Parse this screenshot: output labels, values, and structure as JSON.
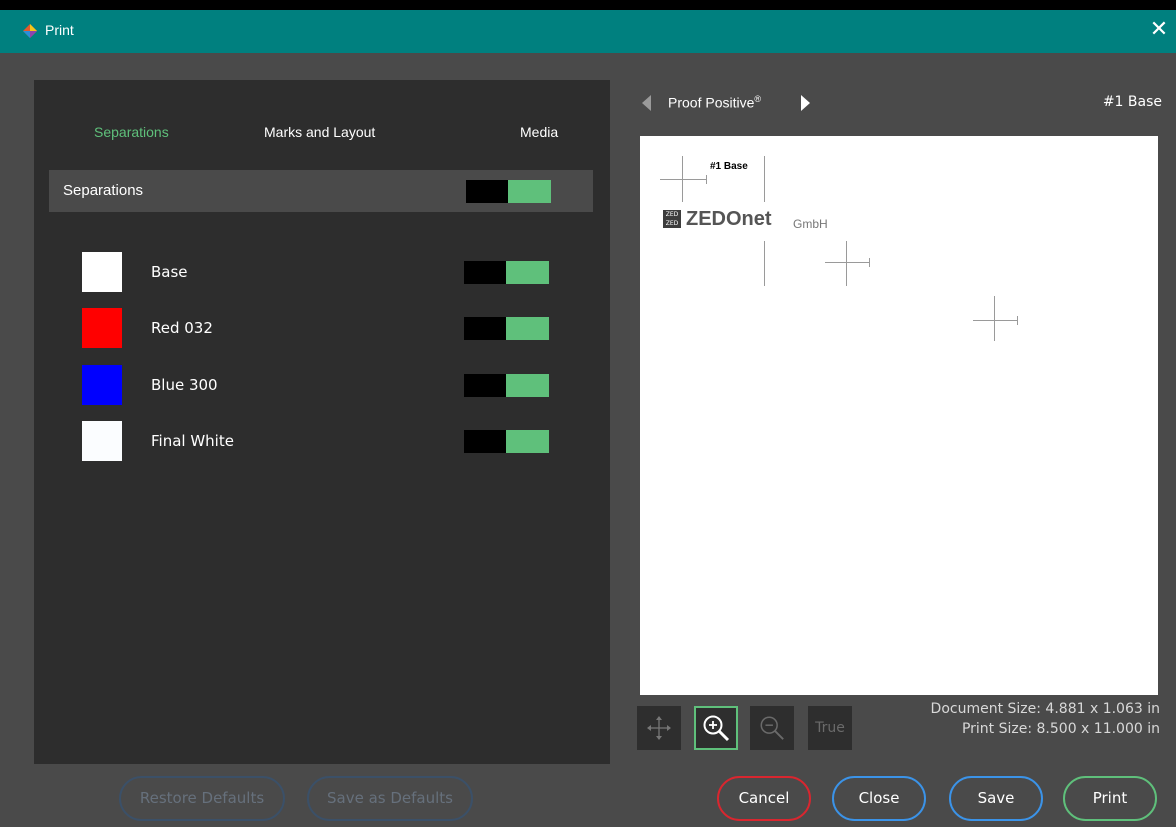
{
  "window": {
    "title": "Print",
    "app_icon": "print-app-icon",
    "close_icon": "close-icon"
  },
  "tabs": [
    {
      "label": "Separations",
      "active": true
    },
    {
      "label": "Marks and Layout",
      "active": false
    },
    {
      "label": "Media",
      "active": false
    }
  ],
  "separations": {
    "header_label": "Separations",
    "master_enabled": true,
    "items": [
      {
        "name": "Base",
        "color": "#ffffff",
        "enabled": true
      },
      {
        "name": "Red 032",
        "color": "#ff0000",
        "enabled": true
      },
      {
        "name": "Blue 300",
        "color": "#0000ff",
        "enabled": true
      },
      {
        "name": "Final White",
        "color": "#fbfdff",
        "enabled": true
      }
    ]
  },
  "left_buttons": {
    "restore": "Restore Defaults",
    "save_defaults": "Save as Defaults"
  },
  "preview": {
    "printer_name": "Proof Positive",
    "registered_mark": "®",
    "current_separation": "#1 Base",
    "mark_label": "#1 Base",
    "logo_text": "ZEDOnet",
    "logo_suffix": "GmbH",
    "logo_box_line1": "ZED",
    "logo_box_line2": "ZED"
  },
  "tools": {
    "pan": "pan-icon",
    "zoom_in": "zoom-in-icon",
    "zoom_out": "zoom-out-icon",
    "true_size": "True"
  },
  "doc_info": {
    "document_size": "Document Size: 4.881 x 1.063  in",
    "print_size": "Print Size: 8.500 x 11.000  in"
  },
  "dialog_buttons": {
    "cancel": "Cancel",
    "close": "Close",
    "save": "Save",
    "print": "Print"
  },
  "colors": {
    "title_bar": "#00807f",
    "accent_green": "#5fc07b",
    "cancel_red": "#d9262f",
    "button_blue": "#3b93e8"
  }
}
